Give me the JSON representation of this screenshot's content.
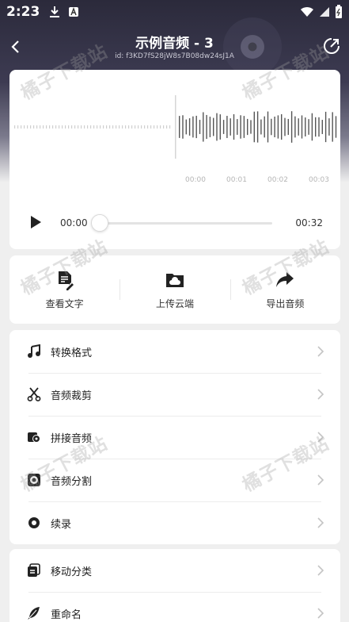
{
  "status": {
    "time": "2:23"
  },
  "header": {
    "title": "示例音频 - 3",
    "subtitle": "id: f3KD7fS28jW8s7B08dw24sJ1A"
  },
  "waveform": {
    "ticks": [
      "00:00",
      "00:01",
      "00:02",
      "00:03"
    ]
  },
  "player": {
    "current_time": "00:00",
    "total_time": "00:32",
    "progress": 0
  },
  "actions": [
    {
      "label": "查看文字",
      "icon": "document-edit-icon"
    },
    {
      "label": "上传云端",
      "icon": "cloud-folder-icon"
    },
    {
      "label": "导出音频",
      "icon": "share-arrow-icon"
    }
  ],
  "menu": [
    {
      "label": "转换格式",
      "icon": "music-note-icon"
    },
    {
      "label": "音频裁剪",
      "icon": "scissors-icon"
    },
    {
      "label": "拼接音频",
      "icon": "stack-record-icon"
    },
    {
      "label": "音频分割",
      "icon": "split-circle-icon"
    },
    {
      "label": "续录",
      "icon": "record-icon"
    }
  ],
  "menu2": [
    {
      "label": "移动分类",
      "icon": "folder-move-icon"
    },
    {
      "label": "重命名",
      "icon": "feather-icon"
    }
  ],
  "watermark": "橘子下载站"
}
